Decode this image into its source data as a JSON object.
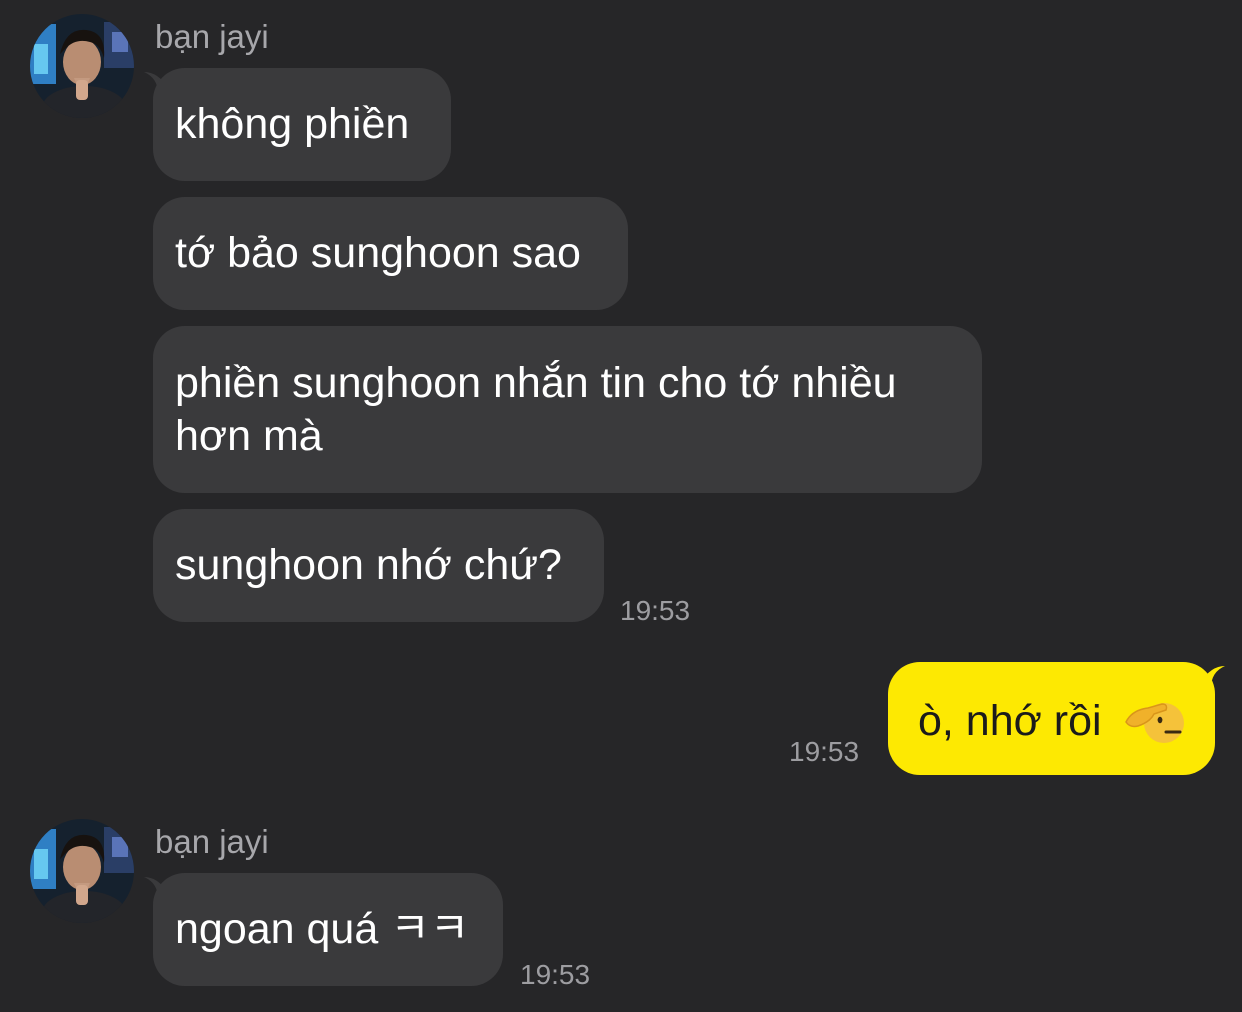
{
  "chat": {
    "messages": [
      {
        "sender": "bạn jayi",
        "bubbles": [
          {
            "text": "không phiền"
          },
          {
            "text": "tớ bảo sunghoon sao"
          },
          {
            "text_line1": "phiền sunghoon nhắn tin cho tớ nhiều",
            "text_line2": "hơn mà"
          },
          {
            "text": "sunghoon nhớ chứ?"
          }
        ],
        "time": "19:53"
      },
      {
        "from_me": true,
        "text": "ò, nhớ rồi",
        "emoji": "saluting-face",
        "time": "19:53"
      },
      {
        "sender": "bạn jayi",
        "bubbles": [
          {
            "text": "ngoan quá ㅋㅋ"
          }
        ],
        "time": "19:53"
      }
    ]
  },
  "colors": {
    "background": "#262628",
    "incoming_bubble": "#3a3a3c",
    "outgoing_bubble": "#fde902",
    "sender_name": "#a7a7ab",
    "timestamp": "#9d9da1"
  }
}
